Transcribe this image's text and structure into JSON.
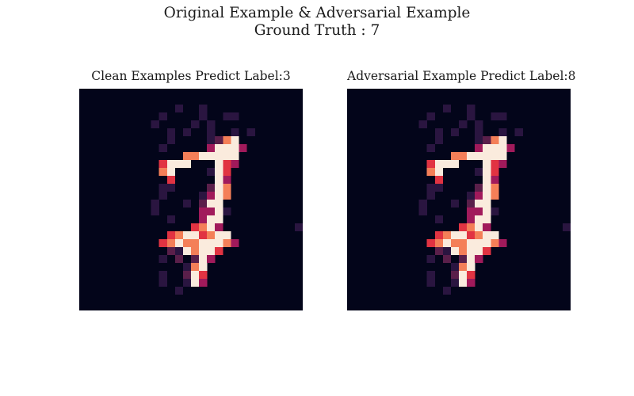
{
  "figure": {
    "title_line1": "Original Example & Adversarial Example",
    "title_line2": "Ground Truth : 7"
  },
  "panels": [
    {
      "title": "Clean Examples Predict Label:3"
    },
    {
      "title": "Adversarial Example Predict Label:8"
    }
  ],
  "colors": {
    "background": "#03051a",
    "low": "#2a1540",
    "mid_low": "#5a1f4a",
    "mid": "#a11a5b",
    "mid_high": "#e13342",
    "high": "#f47f58",
    "peak": "#faebdd"
  }
}
